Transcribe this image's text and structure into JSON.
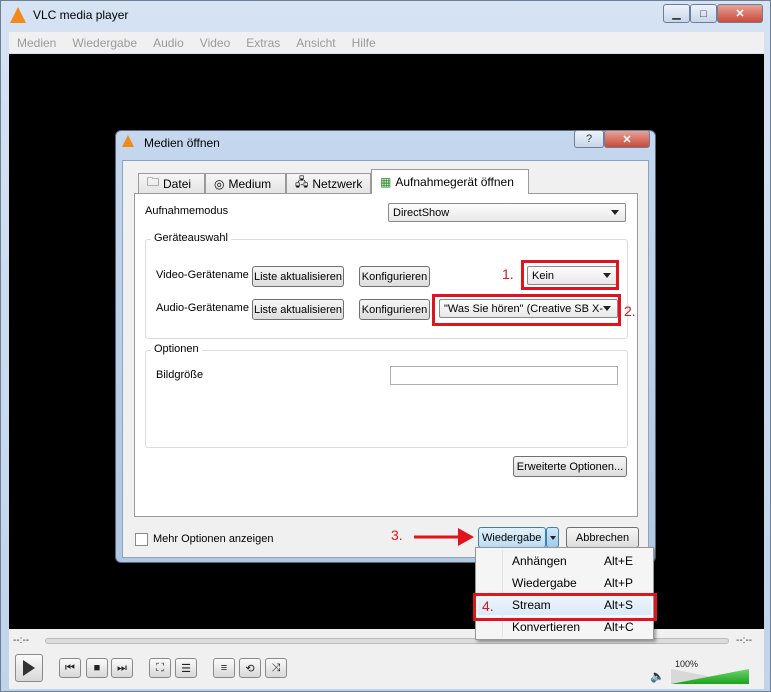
{
  "window": {
    "title": "VLC media player",
    "controls": {
      "minimize": "▁",
      "maximize": "□",
      "close": "✕"
    }
  },
  "menubar": [
    "Medien",
    "Wiedergabe",
    "Audio",
    "Video",
    "Extras",
    "Ansicht",
    "Hilfe"
  ],
  "player": {
    "time_elapsed": "--:--",
    "time_total": "--:--",
    "volume_label": "100%",
    "volume_level": 1.0
  },
  "dialog": {
    "title": "Medien öffnen",
    "help": "?",
    "close": "✕",
    "tabs": [
      "Datei",
      "Medium",
      "Netzwerk",
      "Aufnahmegerät öffnen"
    ],
    "capture_mode_label": "Aufnahmemodus",
    "capture_mode_value": "DirectShow",
    "device_group": "Geräteauswahl",
    "video_device_label": "Video-Gerätename",
    "audio_device_label": "Audio-Gerätename",
    "refresh_list": "Liste aktualisieren",
    "configure": "Konfigurieren",
    "video_device_value": "Kein",
    "audio_device_value": "\"Was Sie hören\" (Creative SB X-",
    "options_group": "Optionen",
    "picture_size_label": "Bildgröße",
    "picture_size_value": "",
    "advanced_options": "Erweiterte Optionen...",
    "more_options": "Mehr Optionen anzeigen",
    "play_button": "Wiedergabe",
    "cancel_button": "Abbrechen"
  },
  "annotations": {
    "one": "1.",
    "two": "2.",
    "three": "3.",
    "four": "4.",
    "color": "#e0141c"
  },
  "dropdown_menu": [
    {
      "label": "Anhängen",
      "shortcut": "Alt+E"
    },
    {
      "label": "Wiedergabe",
      "shortcut": "Alt+P"
    },
    {
      "label": "Stream",
      "shortcut": "Alt+S"
    },
    {
      "label": "Konvertieren",
      "shortcut": "Alt+C"
    }
  ]
}
